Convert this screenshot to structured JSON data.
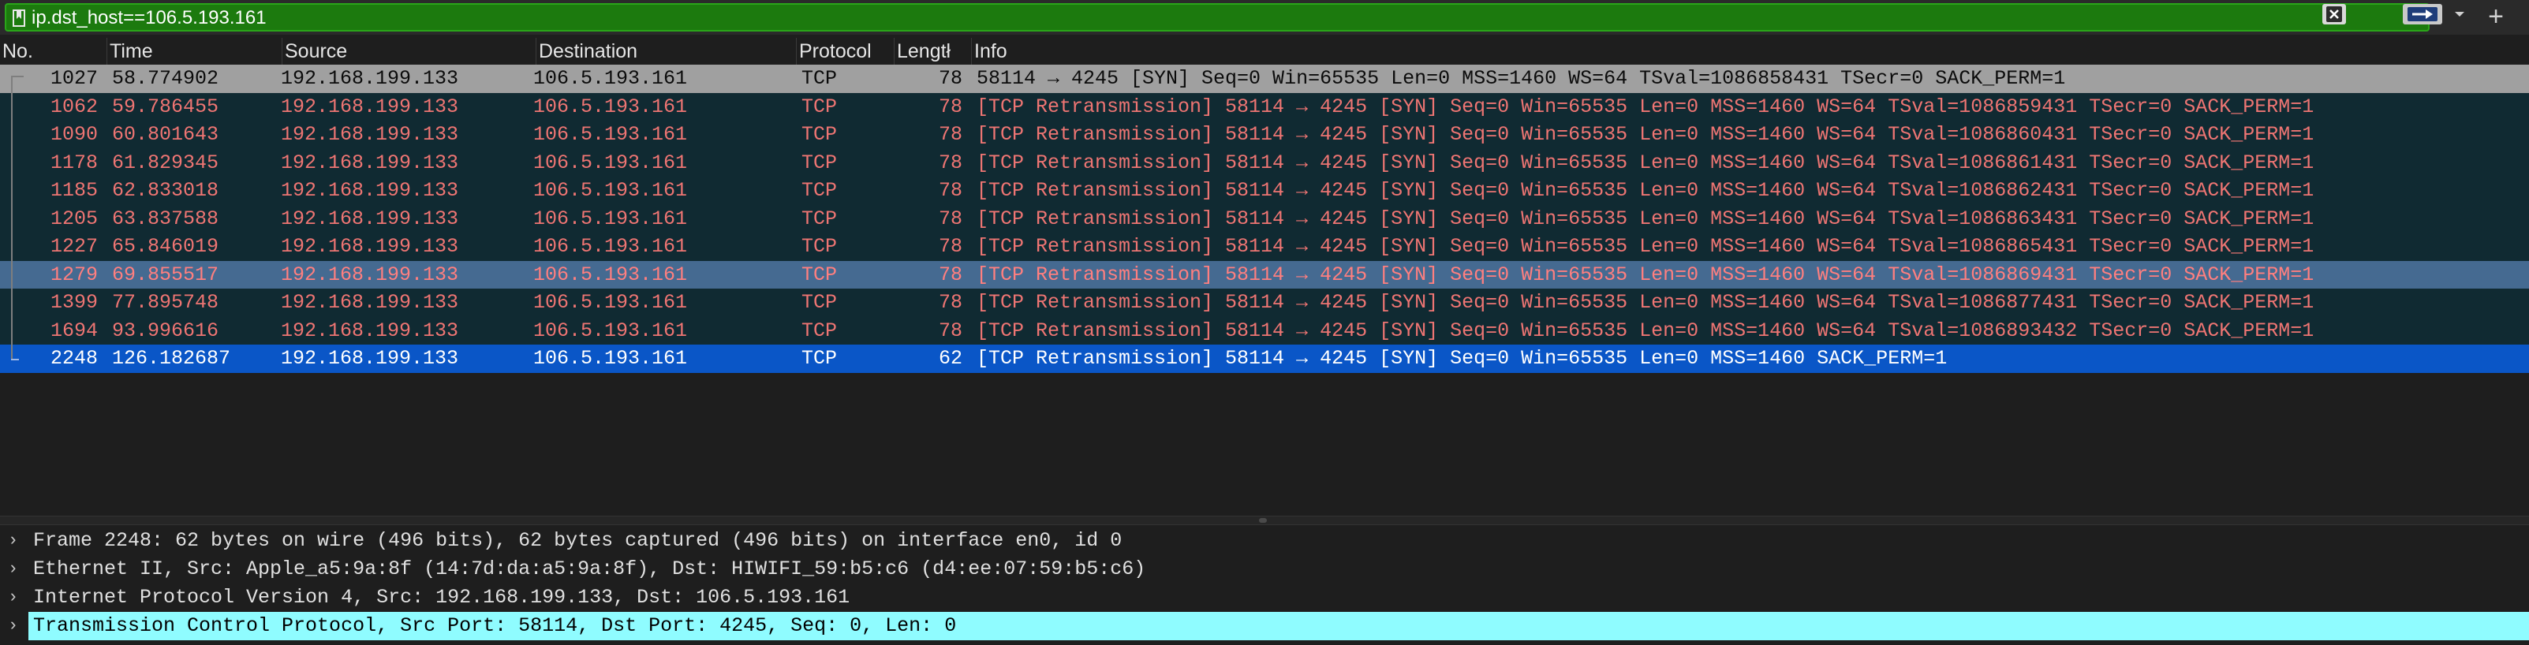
{
  "filter": {
    "value": "ip.dst_host==106.5.193.161",
    "bookmark_icon": "bookmark-icon",
    "clear_icon": "clear-icon",
    "apply_icon": "arrow-right-icon",
    "dropdown_icon": "chevron-down-icon",
    "add_label": "+",
    "field_color": "#1c7a0e"
  },
  "columns": {
    "no": "No.",
    "time": "Time",
    "source": "Source",
    "destination": "Destination",
    "protocol": "Protocol",
    "length": "Lengtł",
    "info": "Info"
  },
  "packets": [
    {
      "no": "1027",
      "time": "58.774902",
      "source": "192.168.199.133",
      "destination": "106.5.193.161",
      "protocol": "TCP",
      "length": "78",
      "info": "58114 → 4245 [SYN] Seq=0 Win=65535 Len=0 MSS=1460 WS=64 TSval=1086858431 TSecr=0 SACK_PERM=1",
      "style": "syn"
    },
    {
      "no": "1062",
      "time": "59.786455",
      "source": "192.168.199.133",
      "destination": "106.5.193.161",
      "protocol": "TCP",
      "length": "78",
      "info": "[TCP Retransmission] 58114 → 4245 [SYN] Seq=0 Win=65535 Len=0 MSS=1460 WS=64 TSval=1086859431 TSecr=0 SACK_PERM=1",
      "style": "retrans"
    },
    {
      "no": "1090",
      "time": "60.801643",
      "source": "192.168.199.133",
      "destination": "106.5.193.161",
      "protocol": "TCP",
      "length": "78",
      "info": "[TCP Retransmission] 58114 → 4245 [SYN] Seq=0 Win=65535 Len=0 MSS=1460 WS=64 TSval=1086860431 TSecr=0 SACK_PERM=1",
      "style": "retrans"
    },
    {
      "no": "1178",
      "time": "61.829345",
      "source": "192.168.199.133",
      "destination": "106.5.193.161",
      "protocol": "TCP",
      "length": "78",
      "info": "[TCP Retransmission] 58114 → 4245 [SYN] Seq=0 Win=65535 Len=0 MSS=1460 WS=64 TSval=1086861431 TSecr=0 SACK_PERM=1",
      "style": "retrans"
    },
    {
      "no": "1185",
      "time": "62.833018",
      "source": "192.168.199.133",
      "destination": "106.5.193.161",
      "protocol": "TCP",
      "length": "78",
      "info": "[TCP Retransmission] 58114 → 4245 [SYN] Seq=0 Win=65535 Len=0 MSS=1460 WS=64 TSval=1086862431 TSecr=0 SACK_PERM=1",
      "style": "retrans"
    },
    {
      "no": "1205",
      "time": "63.837588",
      "source": "192.168.199.133",
      "destination": "106.5.193.161",
      "protocol": "TCP",
      "length": "78",
      "info": "[TCP Retransmission] 58114 → 4245 [SYN] Seq=0 Win=65535 Len=0 MSS=1460 WS=64 TSval=1086863431 TSecr=0 SACK_PERM=1",
      "style": "retrans"
    },
    {
      "no": "1227",
      "time": "65.846019",
      "source": "192.168.199.133",
      "destination": "106.5.193.161",
      "protocol": "TCP",
      "length": "78",
      "info": "[TCP Retransmission] 58114 → 4245 [SYN] Seq=0 Win=65535 Len=0 MSS=1460 WS=64 TSval=1086865431 TSecr=0 SACK_PERM=1",
      "style": "retrans"
    },
    {
      "no": "1279",
      "time": "69.855517",
      "source": "192.168.199.133",
      "destination": "106.5.193.161",
      "protocol": "TCP",
      "length": "78",
      "info": "[TCP Retransmission] 58114 → 4245 [SYN] Seq=0 Win=65535 Len=0 MSS=1460 WS=64 TSval=1086869431 TSecr=0 SACK_PERM=1",
      "style": "retrans sel-related"
    },
    {
      "no": "1399",
      "time": "77.895748",
      "source": "192.168.199.133",
      "destination": "106.5.193.161",
      "protocol": "TCP",
      "length": "78",
      "info": "[TCP Retransmission] 58114 → 4245 [SYN] Seq=0 Win=65535 Len=0 MSS=1460 WS=64 TSval=1086877431 TSecr=0 SACK_PERM=1",
      "style": "retrans"
    },
    {
      "no": "1694",
      "time": "93.996616",
      "source": "192.168.199.133",
      "destination": "106.5.193.161",
      "protocol": "TCP",
      "length": "78",
      "info": "[TCP Retransmission] 58114 → 4245 [SYN] Seq=0 Win=65535 Len=0 MSS=1460 WS=64 TSval=1086893432 TSecr=0 SACK_PERM=1",
      "style": "retrans"
    },
    {
      "no": "2248",
      "time": "126.182687",
      "source": "192.168.199.133",
      "destination": "106.5.193.161",
      "protocol": "TCP",
      "length": "62",
      "info": "[TCP Retransmission] 58114 → 4245 [SYN] Seq=0 Win=65535 Len=0 MSS=1460 SACK_PERM=1",
      "style": "selected"
    }
  ],
  "details": [
    {
      "text": "Frame 2248: 62 bytes on wire (496 bits), 62 bytes captured (496 bits) on interface en0, id 0",
      "icon": "chevron-right-icon",
      "highlight": false
    },
    {
      "text": "Ethernet II, Src: Apple_a5:9a:8f (14:7d:da:a5:9a:8f), Dst: HIWIFI_59:b5:c6 (d4:ee:07:59:b5:c6)",
      "icon": "chevron-right-icon",
      "highlight": false
    },
    {
      "text": "Internet Protocol Version 4, Src: 192.168.199.133, Dst: 106.5.193.161",
      "icon": "chevron-right-icon",
      "highlight": false
    },
    {
      "text": "Transmission Control Protocol, Src Port: 58114, Dst Port: 4245, Seq: 0, Len: 0",
      "icon": "chevron-right-icon",
      "highlight": true
    }
  ],
  "colors": {
    "syn_row": "#a0a0a0",
    "retrans_bg": "#102a32",
    "retrans_fg": "#ee7573",
    "selected_bg": "#0a56c7",
    "highlight_detail": "#8ffcff"
  }
}
